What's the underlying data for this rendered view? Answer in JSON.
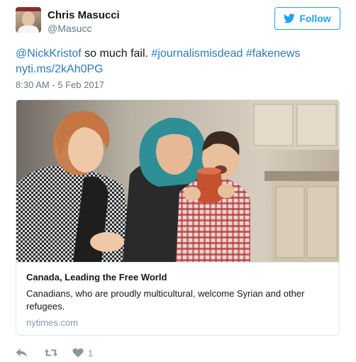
{
  "user": {
    "name": "Chris Masucci",
    "handle": "@Masucc"
  },
  "follow_button": {
    "label": "Follow"
  },
  "tweet": {
    "mention": "@NickKristof",
    "text_middle": " so much fail. ",
    "hashtag_1": "#journalismisdead",
    "space": " ",
    "hashtag_2": "#fakenews",
    "link": "nyti.ms/2kAh0PG",
    "timestamp": "8:30 AM - 5 Feb 2017"
  },
  "card": {
    "title": "Canada, Leading the Free World",
    "description": "Canadians, who are proudly multicultural, welcome Syrian and other refugees.",
    "domain": "nytimes.com"
  },
  "actions": {
    "reply_icon": "reply-icon",
    "retweet_icon": "retweet-icon",
    "like_icon": "heart-icon",
    "like_count": "1"
  },
  "colors": {
    "accent": "#1da1f2",
    "link": "#2b7bb9",
    "muted": "#657786",
    "icon": "#8899a6"
  }
}
